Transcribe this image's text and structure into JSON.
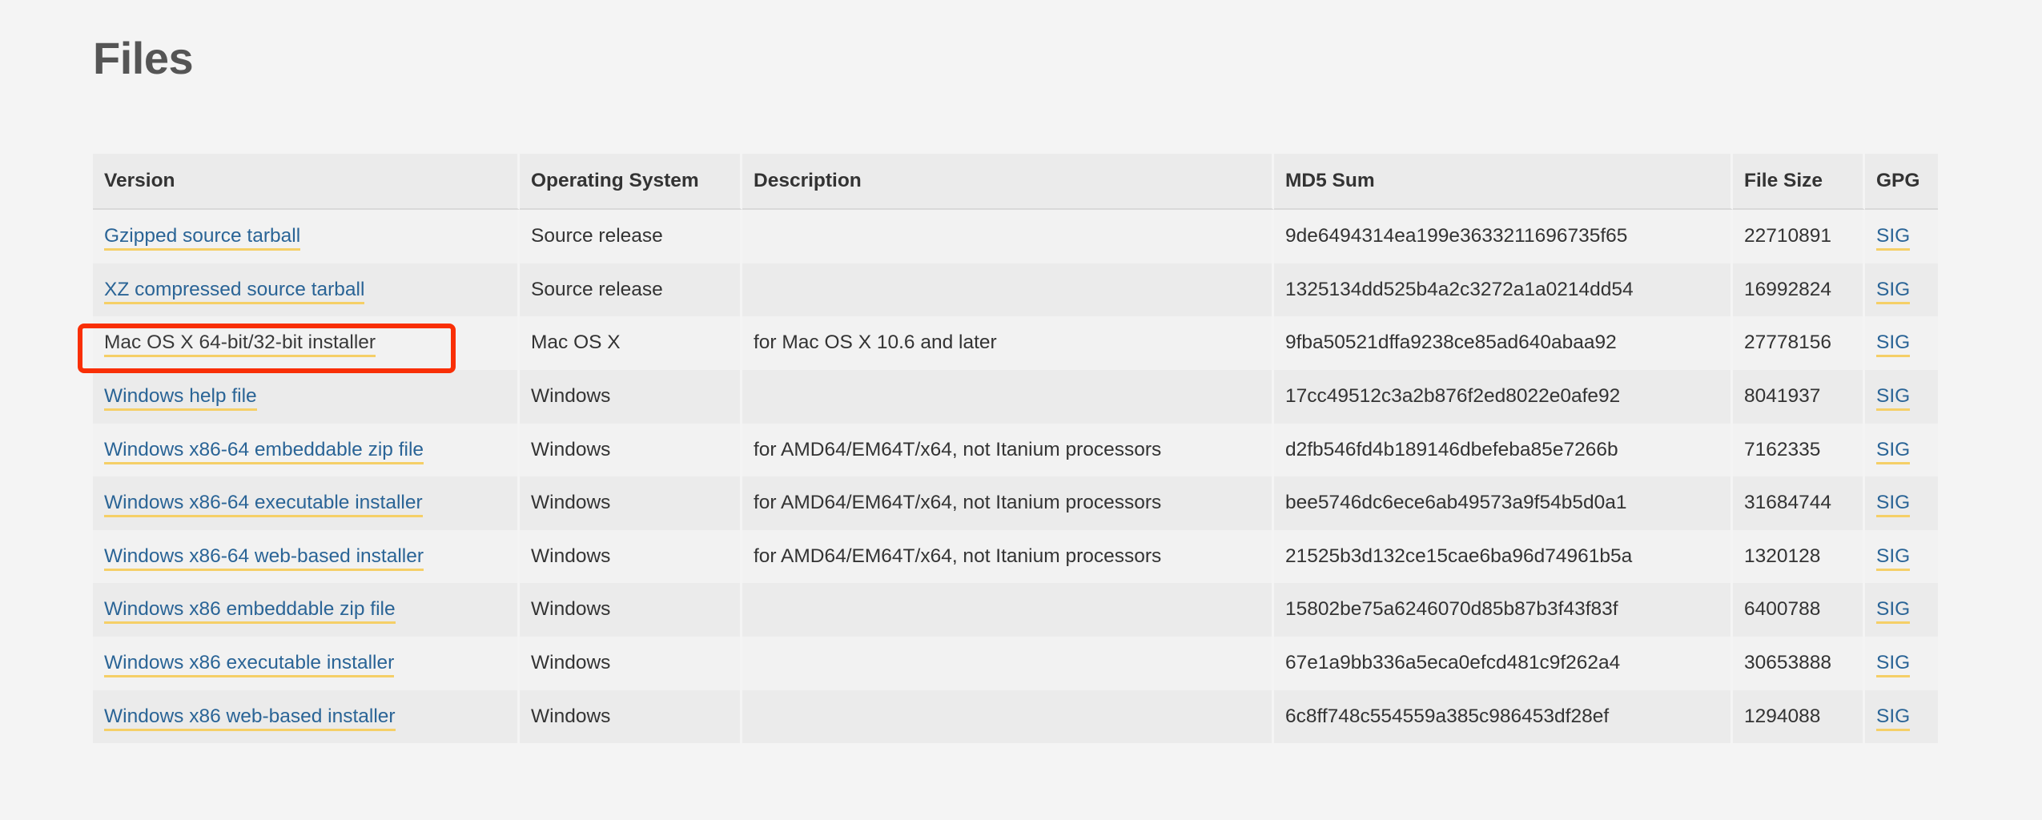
{
  "page": {
    "title": "Files",
    "background_color": "#f4f4f4"
  },
  "colors": {
    "link": "#2a6496",
    "link_underline": "#f5cf67",
    "highlight_border": "#f92f06",
    "header_bg": "#ebebeb",
    "row_odd_bg": "#f2f2f2",
    "row_even_bg": "#ebebeb",
    "text": "#333333",
    "heading": "#555555"
  },
  "table": {
    "name": "files-table",
    "columns": [
      {
        "key": "version",
        "label": "Version"
      },
      {
        "key": "os",
        "label": "Operating System"
      },
      {
        "key": "description",
        "label": "Description"
      },
      {
        "key": "md5",
        "label": "MD5 Sum"
      },
      {
        "key": "size",
        "label": "File Size"
      },
      {
        "key": "gpg",
        "label": "GPG"
      }
    ],
    "rows": [
      {
        "version": "Gzipped source tarball",
        "version_is_link": true,
        "os": "Source release",
        "description": "",
        "md5": "9de6494314ea199e3633211696735f65",
        "size": "22710891",
        "gpg": "SIG",
        "highlighted": false
      },
      {
        "version": "XZ compressed source tarball",
        "version_is_link": true,
        "os": "Source release",
        "description": "",
        "md5": "1325134dd525b4a2c3272a1a0214dd54",
        "size": "16992824",
        "gpg": "SIG",
        "highlighted": false
      },
      {
        "version": "Mac OS X 64-bit/32-bit installer",
        "version_is_link": true,
        "os": "Mac OS X",
        "description": "for Mac OS X 10.6 and later",
        "md5": "9fba50521dffa9238ce85ad640abaa92",
        "size": "27778156",
        "gpg": "SIG",
        "highlighted": true
      },
      {
        "version": "Windows help file",
        "version_is_link": true,
        "os": "Windows",
        "description": "",
        "md5": "17cc49512c3a2b876f2ed8022e0afe92",
        "size": "8041937",
        "gpg": "SIG",
        "highlighted": false
      },
      {
        "version": "Windows x86-64 embeddable zip file",
        "version_is_link": true,
        "os": "Windows",
        "description": "for AMD64/EM64T/x64, not Itanium processors",
        "md5": "d2fb546fd4b189146dbefeba85e7266b",
        "size": "7162335",
        "gpg": "SIG",
        "highlighted": false
      },
      {
        "version": "Windows x86-64 executable installer",
        "version_is_link": true,
        "os": "Windows",
        "description": "for AMD64/EM64T/x64, not Itanium processors",
        "md5": "bee5746dc6ece6ab49573a9f54b5d0a1",
        "size": "31684744",
        "gpg": "SIG",
        "highlighted": false
      },
      {
        "version": "Windows x86-64 web-based installer",
        "version_is_link": true,
        "os": "Windows",
        "description": "for AMD64/EM64T/x64, not Itanium processors",
        "md5": "21525b3d132ce15cae6ba96d74961b5a",
        "size": "1320128",
        "gpg": "SIG",
        "highlighted": false
      },
      {
        "version": "Windows x86 embeddable zip file",
        "version_is_link": true,
        "os": "Windows",
        "description": "",
        "md5": "15802be75a6246070d85b87b3f43f83f",
        "size": "6400788",
        "gpg": "SIG",
        "highlighted": false
      },
      {
        "version": "Windows x86 executable installer",
        "version_is_link": true,
        "os": "Windows",
        "description": "",
        "md5": "67e1a9bb336a5eca0efcd481c9f262a4",
        "size": "30653888",
        "gpg": "SIG",
        "highlighted": false
      },
      {
        "version": "Windows x86 web-based installer",
        "version_is_link": true,
        "os": "Windows",
        "description": "",
        "md5": "6c8ff748c554559a385c986453df28ef",
        "size": "1294088",
        "gpg": "SIG",
        "highlighted": false
      }
    ]
  }
}
